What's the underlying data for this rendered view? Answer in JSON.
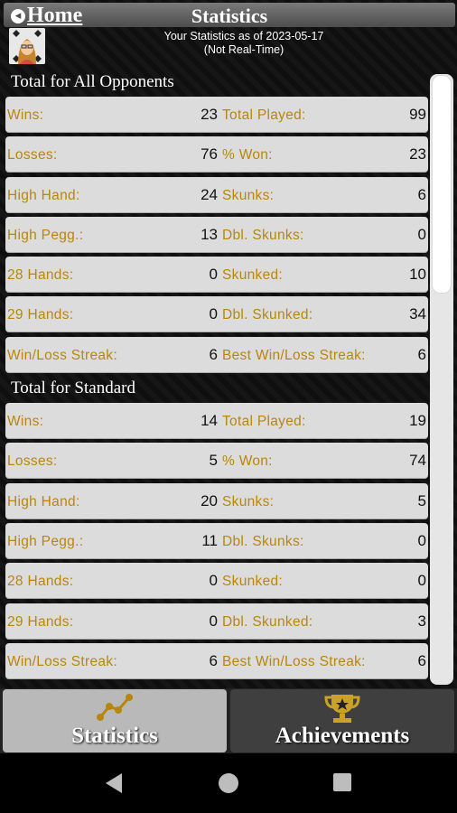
{
  "header": {
    "home_label": "Home",
    "title": "Statistics",
    "subtitle_line1": "Your Statistics as of 2023-05-17",
    "subtitle_line2": "(Not Real-Time)"
  },
  "sections": [
    {
      "title": "Total for All Opponents",
      "rows": [
        {
          "l1": "Wins:",
          "v1": "23",
          "l2": "Total Played:",
          "v2": "99"
        },
        {
          "l1": "Losses:",
          "v1": "76",
          "l2": "% Won:",
          "v2": "23"
        },
        {
          "l1": "High Hand:",
          "v1": "24",
          "l2": "Skunks:",
          "v2": "6"
        },
        {
          "l1": "High Pegg.:",
          "v1": "13",
          "l2": "Dbl. Skunks:",
          "v2": "0"
        },
        {
          "l1": "28 Hands:",
          "v1": "0",
          "l2": "Skunked:",
          "v2": "10"
        },
        {
          "l1": "29 Hands:",
          "v1": "0",
          "l2": "Dbl. Skunked:",
          "v2": "34"
        },
        {
          "l1": "Win/Loss Streak:",
          "v1": "6",
          "l2": "Best Win/Loss Streak:",
          "v2": "6"
        }
      ]
    },
    {
      "title": "Total for Standard",
      "rows": [
        {
          "l1": "Wins:",
          "v1": "14",
          "l2": "Total Played:",
          "v2": "19"
        },
        {
          "l1": "Losses:",
          "v1": "5",
          "l2": "% Won:",
          "v2": "74"
        },
        {
          "l1": "High Hand:",
          "v1": "20",
          "l2": "Skunks:",
          "v2": "5"
        },
        {
          "l1": "High Pegg.:",
          "v1": "11",
          "l2": "Dbl. Skunks:",
          "v2": "0"
        },
        {
          "l1": "28 Hands:",
          "v1": "0",
          "l2": "Skunked:",
          "v2": "0"
        },
        {
          "l1": "29 Hands:",
          "v1": "0",
          "l2": "Dbl. Skunked:",
          "v2": "3"
        },
        {
          "l1": "Win/Loss Streak:",
          "v1": "6",
          "l2": "Best Win/Loss Streak:",
          "v2": "6"
        }
      ]
    }
  ],
  "tabs": [
    {
      "label": "Statistics",
      "icon": "chart-line-icon",
      "active": true
    },
    {
      "label": "Achievements",
      "icon": "trophy-icon",
      "active": false
    }
  ],
  "colors": {
    "label_gold": "#b8860b",
    "row_bg": "#dcdcdc"
  }
}
